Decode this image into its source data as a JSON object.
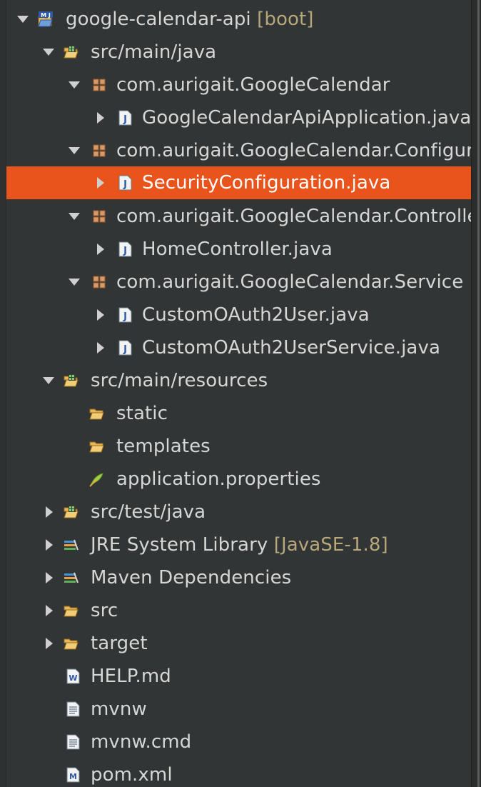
{
  "tree": {
    "project": {
      "name": "google-calendar-api",
      "decoration": "[boot]",
      "badge": "M J"
    },
    "items": [
      {
        "label": "src/main/java"
      },
      {
        "label": "com.aurigait.GoogleCalendar"
      },
      {
        "label": "GoogleCalendarApiApplication.java"
      },
      {
        "label": "com.aurigait.GoogleCalendar.Configuration"
      },
      {
        "label": "SecurityConfiguration.java"
      },
      {
        "label": "com.aurigait.GoogleCalendar.Controller"
      },
      {
        "label": "HomeController.java"
      },
      {
        "label": "com.aurigait.GoogleCalendar.Service"
      },
      {
        "label": "CustomOAuth2User.java"
      },
      {
        "label": "CustomOAuth2UserService.java"
      },
      {
        "label": "src/main/resources"
      },
      {
        "label": "static"
      },
      {
        "label": "templates"
      },
      {
        "label": "application.properties"
      },
      {
        "label": "src/test/java"
      },
      {
        "label": "JRE System Library",
        "decoration": "[JavaSE-1.8]"
      },
      {
        "label": "Maven Dependencies"
      },
      {
        "label": "src"
      },
      {
        "label": "target"
      },
      {
        "label": "HELP.md"
      },
      {
        "label": "mvnw"
      },
      {
        "label": "mvnw.cmd"
      },
      {
        "label": "pom.xml"
      }
    ]
  },
  "colors": {
    "selection": "#e9541c",
    "background": "#323535",
    "text": "#d6d6d4",
    "decoration": "#b8a77a"
  },
  "icons": {
    "expanded": "triangle-down-icon",
    "collapsed": "triangle-right-icon",
    "package": "package-icon",
    "java_file": "java-file-icon",
    "folder": "folder-icon",
    "source_folder": "source-folder-icon",
    "library": "library-icon",
    "properties": "properties-file-icon",
    "markdown": "markdown-file-icon",
    "text_file": "text-file-icon",
    "maven": "maven-pom-icon"
  }
}
